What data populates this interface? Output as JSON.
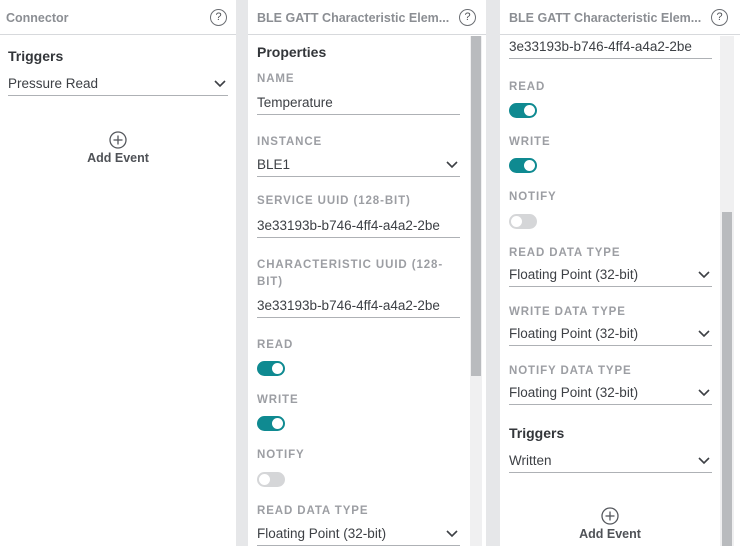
{
  "connector_panel": {
    "title": "Connector",
    "help_label": "?",
    "triggers_heading": "Triggers",
    "trigger_select": "Pressure Read",
    "add_event_label": "Add Event"
  },
  "gatt_panel_main": {
    "title": "BLE GATT Characteristic Elem...",
    "help_label": "?",
    "properties_heading": "Properties",
    "name_label": "NAME",
    "name_value": "Temperature",
    "instance_label": "INSTANCE",
    "instance_value": "BLE1",
    "service_uuid_label": "SERVICE UUID (128-BIT)",
    "service_uuid_value": "3e33193b-b746-4ff4-a4a2-2be",
    "char_uuid_label_line1": "CHARACTERISTIC UUID (128-",
    "char_uuid_label_line2": "BIT)",
    "char_uuid_value": "3e33193b-b746-4ff4-a4a2-2be",
    "read_label": "READ",
    "read_on": true,
    "write_label": "WRITE",
    "write_on": true,
    "notify_label": "NOTIFY",
    "notify_on": false,
    "read_data_type_label": "READ DATA TYPE",
    "read_data_type_value": "Floating Point (32-bit)"
  },
  "gatt_panel_scrolled": {
    "title": "BLE GATT Characteristic Elem...",
    "help_label": "?",
    "char_uuid_value": "3e33193b-b746-4ff4-a4a2-2be",
    "read_label": "READ",
    "read_on": true,
    "write_label": "WRITE",
    "write_on": true,
    "notify_label": "NOTIFY",
    "notify_on": false,
    "read_data_type_label": "READ DATA TYPE",
    "read_data_type_value": "Floating Point (32-bit)",
    "write_data_type_label": "WRITE DATA TYPE",
    "write_data_type_value": "Floating Point (32-bit)",
    "notify_data_type_label": "NOTIFY DATA TYPE",
    "notify_data_type_value": "Floating Point (32-bit)",
    "triggers_heading": "Triggers",
    "trigger_select": "Written",
    "add_event_label": "Add Event"
  },
  "colors": {
    "toggle_on": "#0f8a91",
    "toggle_off": "#d5d6d8",
    "panel_gap": "#e6e7e9"
  },
  "icons": {
    "help": "help-circle-icon",
    "dropdown": "chevron-down-icon",
    "add": "plus-circle-icon"
  }
}
